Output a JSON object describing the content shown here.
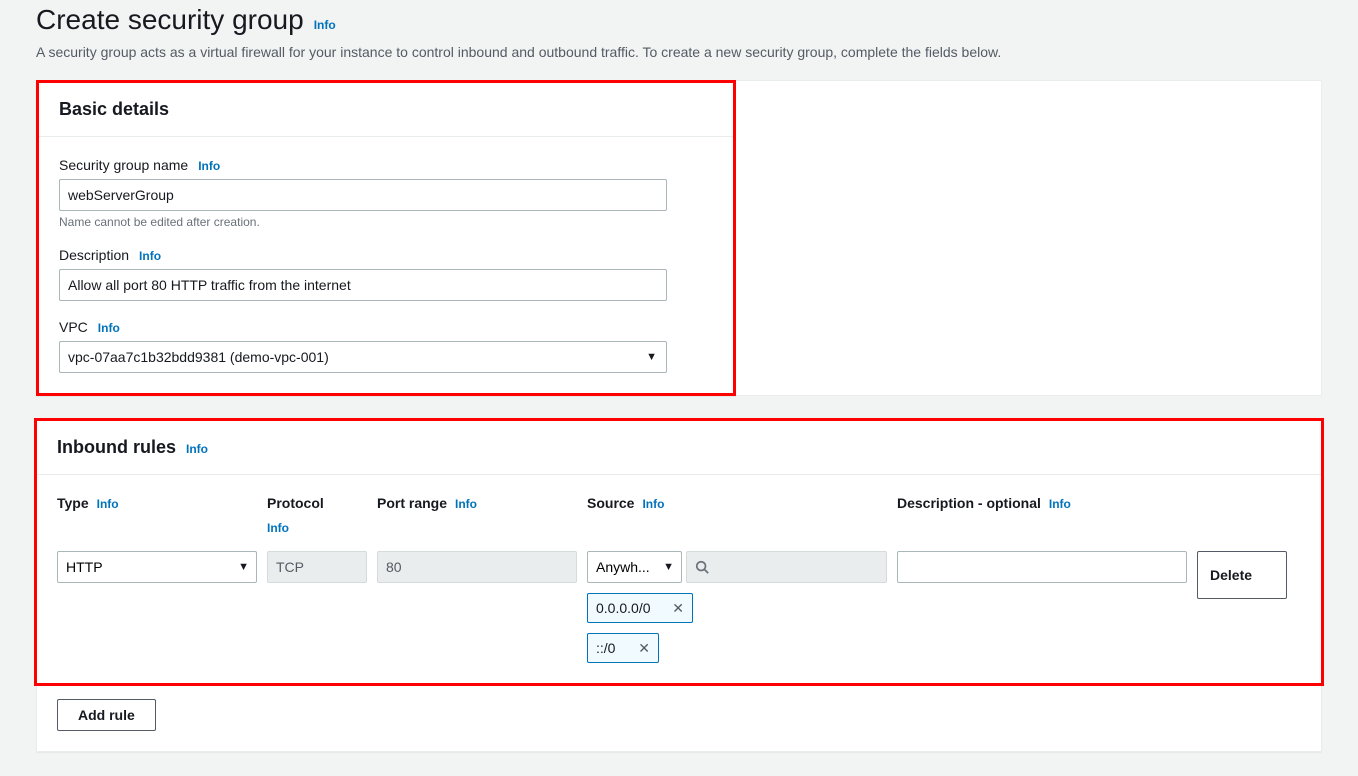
{
  "page": {
    "title": "Create security group",
    "info_label": "Info",
    "subtitle": "A security group acts as a virtual firewall for your instance to control inbound and outbound traffic. To create a new security group, complete the fields below."
  },
  "basic": {
    "panel_title": "Basic details",
    "name_label": "Security group name",
    "name_value": "webServerGroup",
    "name_helper": "Name cannot be edited after creation.",
    "desc_label": "Description",
    "desc_value": "Allow all port 80 HTTP traffic from the internet",
    "vpc_label": "VPC",
    "vpc_value": "vpc-07aa7c1b32bdd9381 (demo-vpc-001)"
  },
  "inbound": {
    "panel_title": "Inbound rules",
    "info_label": "Info",
    "headers": {
      "type": "Type",
      "protocol": "Protocol",
      "port_range": "Port range",
      "source": "Source",
      "description": "Description - optional"
    },
    "rule": {
      "type_value": "HTTP",
      "protocol_value": "TCP",
      "port_value": "80",
      "source_type_value": "Anywh...",
      "source_tags": [
        "0.0.0.0/0",
        "::/0"
      ],
      "desc_value": "",
      "delete_label": "Delete"
    },
    "add_rule_label": "Add rule"
  }
}
